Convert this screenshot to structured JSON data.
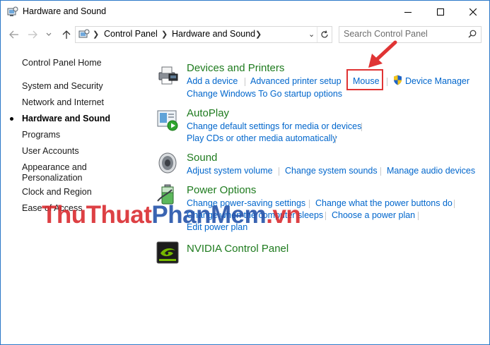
{
  "window": {
    "title": "Hardware and Sound"
  },
  "address": {
    "crumbs": [
      "Control Panel",
      "Hardware and Sound"
    ]
  },
  "search": {
    "placeholder": "Search Control Panel"
  },
  "sidebar": {
    "items": [
      {
        "label": "Control Panel Home"
      },
      {
        "label": "System and Security"
      },
      {
        "label": "Network and Internet"
      },
      {
        "label": "Hardware and Sound",
        "active": true
      },
      {
        "label": "Programs"
      },
      {
        "label": "User Accounts"
      },
      {
        "label": "Appearance and"
      },
      {
        "label": "Personalization"
      },
      {
        "label": "Clock and Region"
      },
      {
        "label": "Ease of Access"
      }
    ]
  },
  "sections": {
    "devices": {
      "title": "Devices and Printers",
      "links": [
        "Add a device",
        "Advanced printer setup",
        "Mouse",
        "Device Manager",
        "Change Windows To Go startup options"
      ]
    },
    "autoplay": {
      "title": "AutoPlay",
      "links": [
        "Change default settings for media or devices",
        "Play CDs or other media automatically"
      ]
    },
    "sound": {
      "title": "Sound",
      "links": [
        "Adjust system volume",
        "Change system sounds",
        "Manage audio devices"
      ]
    },
    "power": {
      "title": "Power Options",
      "links": [
        "Change power-saving settings",
        "Change what the power buttons do",
        "Change when the computer sleeps",
        "Choose a power plan",
        "Edit power plan"
      ]
    },
    "nvidia": {
      "title": "NVIDIA Control Panel"
    }
  },
  "watermark": {
    "part1": "ThuThuat",
    "part2": "PhanMem",
    "part3": ".vn"
  },
  "colors": {
    "link": "#0066cc",
    "section_title": "#1e7b1e",
    "highlight": "#e03434",
    "accent": "#2b78c8"
  }
}
